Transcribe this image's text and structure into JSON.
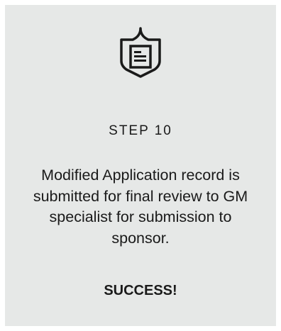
{
  "card": {
    "background_color": "#e6e8e7",
    "icon": "document-shield-icon",
    "step_label": "STEP 10",
    "description": "Modified Application record is submitted for final review  to GM specialist  for submission to sponsor.",
    "status": "SUCCESS!"
  }
}
